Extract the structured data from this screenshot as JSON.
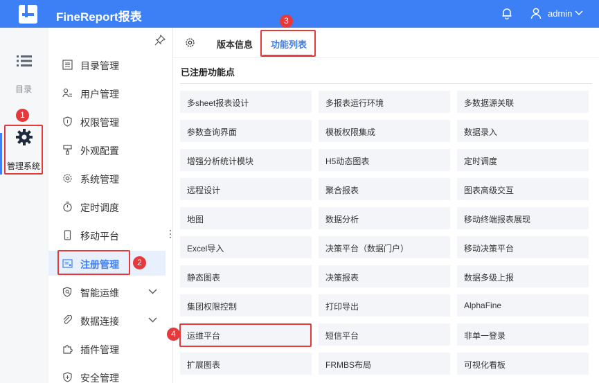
{
  "header": {
    "app_title": "FineReport报表",
    "username": "admin",
    "icons": [
      "logo-icon",
      "bell-icon",
      "user-icon",
      "chevron-down-icon"
    ]
  },
  "rail": {
    "items": [
      {
        "label": "目录",
        "icon": "list-icon",
        "active": false
      },
      {
        "label": "管理系统",
        "icon": "gear-icon",
        "active": true
      }
    ]
  },
  "sidebar": {
    "items": [
      {
        "label": "目录管理",
        "icon": "list-box-icon"
      },
      {
        "label": "用户管理",
        "icon": "user-list-icon"
      },
      {
        "label": "权限管理",
        "icon": "shield-icon"
      },
      {
        "label": "外观配置",
        "icon": "brush-icon"
      },
      {
        "label": "系统管理",
        "icon": "gear-icon"
      },
      {
        "label": "定时调度",
        "icon": "timer-icon"
      },
      {
        "label": "移动平台",
        "icon": "mobile-icon"
      },
      {
        "label": "注册管理",
        "icon": "register-icon",
        "active": true
      },
      {
        "label": "智能运维",
        "icon": "search-shield-icon",
        "expandable": true
      },
      {
        "label": "数据连接",
        "icon": "link-icon",
        "expandable": true
      },
      {
        "label": "插件管理",
        "icon": "plugin-icon"
      },
      {
        "label": "安全管理",
        "icon": "security-icon"
      }
    ]
  },
  "tabs": [
    {
      "label": "版本信息",
      "active": false
    },
    {
      "label": "功能列表",
      "active": true
    }
  ],
  "content": {
    "section_title": "已注册功能点",
    "features": [
      "多sheet报表设计",
      "多报表运行环境",
      "多数据源关联",
      "参数查询界面",
      "模板权限集成",
      "数据录入",
      "增强分析统计模块",
      "H5动态图表",
      "定时调度",
      "远程设计",
      "聚合报表",
      "图表高级交互",
      "地图",
      "数据分析",
      "移动终端报表展现",
      "Excel导入",
      "决策平台（数据门户）",
      "移动决策平台",
      "静态图表",
      "决策报表",
      "数据多级上报",
      "集团权限控制",
      "打印导出",
      "AlphaFine",
      "运维平台",
      "短信平台",
      "非单一登录",
      "扩展图表",
      "FRMBS布局",
      "可视化看板"
    ]
  },
  "annotations": {
    "badges": [
      "1",
      "2",
      "3",
      "4"
    ],
    "color": "#e5393b"
  },
  "colors": {
    "primary": "#3d7ff5",
    "active_bg": "#e8effd",
    "cell_bg": "#f3f5f8",
    "highlight": "#e5393b"
  }
}
